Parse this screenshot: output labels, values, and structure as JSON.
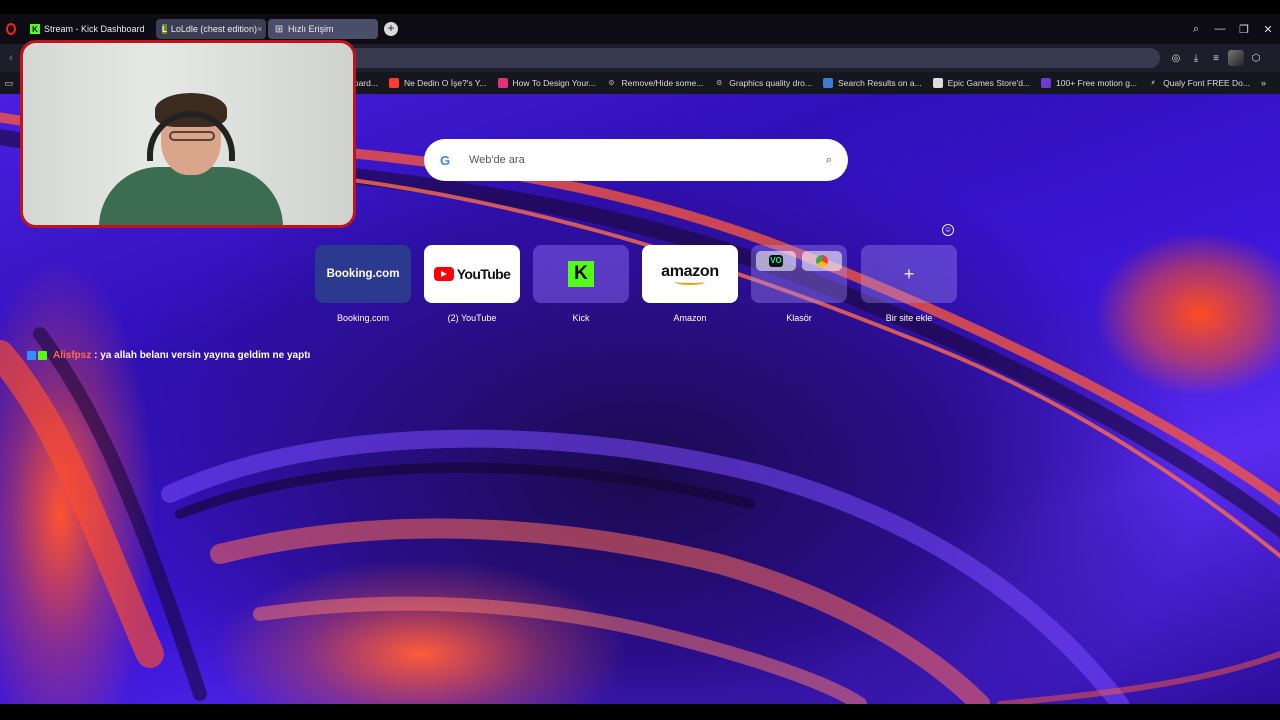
{
  "tabs": [
    {
      "label": "Stream - Kick Dashboard",
      "icon": "kick-favicon",
      "active": false
    },
    {
      "label": "LoLdle (chest edition)",
      "icon": "loldle-favicon",
      "active": true
    },
    {
      "label": "Hızlı Erişim",
      "icon": "grid-icon",
      "active": false
    }
  ],
  "tab_close": "×",
  "new_tab": "+",
  "bookmarks": [
    {
      "label": "nnel dashboard...",
      "icon": "kick-icon",
      "color": "#53fc18"
    },
    {
      "label": "Ne Dedin O İşe?'s Y...",
      "icon": "chart-icon",
      "color": "#ff3b30"
    },
    {
      "label": "How To Design Your...",
      "icon": "figma-icon",
      "color": "#e3307a"
    },
    {
      "label": "Remove/Hide some...",
      "icon": "gear-icon",
      "color": "#999999"
    },
    {
      "label": "Graphics quality dro...",
      "icon": "gear-icon",
      "color": "#999999"
    },
    {
      "label": "Search Results on a...",
      "icon": "search-icon",
      "color": "#3a7bd5"
    },
    {
      "label": "Epic Games Store'd...",
      "icon": "epic-icon",
      "color": "#dddddd"
    },
    {
      "label": "100+ Free motion g...",
      "icon": "motion-icon",
      "color": "#6a3ccf"
    },
    {
      "label": "Qualy Font FREE Do...",
      "icon": "bolt-icon",
      "color": "#ffffff"
    }
  ],
  "bookmarks_more": "»",
  "search": {
    "placeholder": "Web'de ara",
    "engine_icon": "G"
  },
  "speed_dials": [
    {
      "label": "Booking.com",
      "tile_text": "Booking.com"
    },
    {
      "label": "(2) YouTube",
      "tile_text": "YouTube"
    },
    {
      "label": "Kick",
      "tile_text": "K"
    },
    {
      "label": "Amazon",
      "tile_text": "amazon"
    },
    {
      "label": "Klasör",
      "tile_text": "VO"
    },
    {
      "label": "Bir site ekle",
      "tile_text": "+"
    }
  ],
  "chat": {
    "user": "Alisfpsz",
    "separator": " : ",
    "message": "ya allah belanı versin yayına geldim ne yaptı"
  },
  "colors": {
    "accent_red": "#c0141c",
    "kick_green": "#53fc18",
    "wallpaper_purple": "#3b16d8",
    "wallpaper_orange": "#ff5230"
  }
}
